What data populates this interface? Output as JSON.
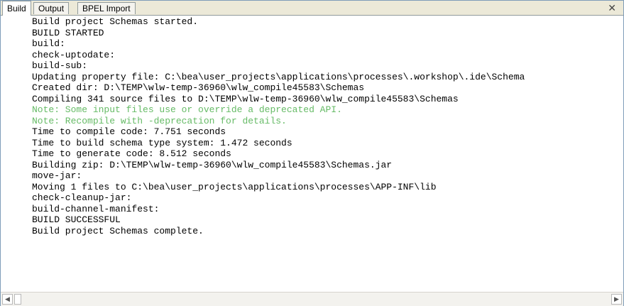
{
  "tabs": [
    {
      "label": "Build"
    },
    {
      "label": "Output"
    },
    {
      "label": "BPEL Import"
    }
  ],
  "close_glyph": "✕",
  "scrollbar": {
    "left_glyph": "◀",
    "right_glyph": "▶"
  },
  "colors": {
    "note": "#66bb66",
    "text": "#000000"
  },
  "lines": [
    {
      "text": "Build project Schemas started.",
      "note": false
    },
    {
      "text": "BUILD STARTED",
      "note": false
    },
    {
      "text": "build:",
      "note": false
    },
    {
      "text": "check-uptodate:",
      "note": false
    },
    {
      "text": "build-sub:",
      "note": false
    },
    {
      "text": "Updating property file: C:\\bea\\user_projects\\applications\\processes\\.workshop\\.ide\\Schema",
      "note": false
    },
    {
      "text": "Created dir: D:\\TEMP\\wlw-temp-36960\\wlw_compile45583\\Schemas",
      "note": false
    },
    {
      "text": "Compiling 341 source files to D:\\TEMP\\wlw-temp-36960\\wlw_compile45583\\Schemas",
      "note": false
    },
    {
      "text": "Note: Some input files use or override a deprecated API.",
      "note": true
    },
    {
      "text": "Note: Recompile with -deprecation for details.",
      "note": true
    },
    {
      "text": "Time to compile code: 7.751 seconds",
      "note": false
    },
    {
      "text": "Time to build schema type system: 1.472 seconds",
      "note": false
    },
    {
      "text": "Time to generate code: 8.512 seconds",
      "note": false
    },
    {
      "text": "Building zip: D:\\TEMP\\wlw-temp-36960\\wlw_compile45583\\Schemas.jar",
      "note": false
    },
    {
      "text": "move-jar:",
      "note": false
    },
    {
      "text": "Moving 1 files to C:\\bea\\user_projects\\applications\\processes\\APP-INF\\lib",
      "note": false
    },
    {
      "text": "check-cleanup-jar:",
      "note": false
    },
    {
      "text": "build-channel-manifest:",
      "note": false
    },
    {
      "text": "BUILD SUCCESSFUL",
      "note": false
    },
    {
      "text": "Build project Schemas complete.",
      "note": false
    }
  ]
}
